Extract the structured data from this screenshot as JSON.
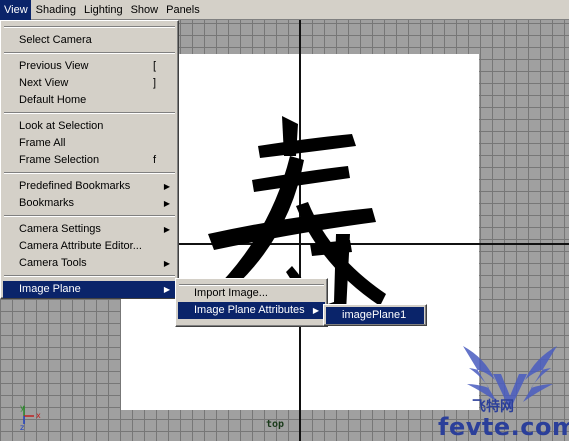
{
  "menubar": {
    "items": [
      {
        "label": "View",
        "active": true
      },
      {
        "label": "Shading",
        "active": false
      },
      {
        "label": "Lighting",
        "active": false
      },
      {
        "label": "Show",
        "active": false
      },
      {
        "label": "Panels",
        "active": false
      }
    ]
  },
  "view_menu": {
    "select_camera": "Select Camera",
    "previous_view": "Previous View",
    "previous_view_shortcut": "[",
    "next_view": "Next View",
    "next_view_shortcut": "]",
    "default_home": "Default Home",
    "look_at_selection": "Look at Selection",
    "frame_all": "Frame All",
    "frame_selection": "Frame Selection",
    "frame_selection_shortcut": "f",
    "predefined_bookmarks": "Predefined Bookmarks",
    "bookmarks": "Bookmarks",
    "camera_settings": "Camera Settings",
    "camera_attribute_editor": "Camera Attribute Editor...",
    "camera_tools": "Camera Tools",
    "image_plane": "Image Plane"
  },
  "image_plane_menu": {
    "import_image": "Import Image...",
    "image_plane_attributes": "Image Plane Attributes"
  },
  "attributes_menu": {
    "items": [
      "imagePlane1"
    ]
  },
  "viewport": {
    "camera_name": "top",
    "image_plane_glyph": "寿",
    "axis_labels": {
      "y": "y",
      "x": "x",
      "z": "z"
    }
  },
  "watermark": {
    "brand": "飞特网",
    "url": "fevte.com",
    "logo_letter": "V"
  },
  "colors": {
    "menu_bg": "#d4d0c8",
    "highlight": "#0a246a",
    "viewport_grid": "#a0a0a0",
    "watermark_blue": "#2b3f9a"
  }
}
